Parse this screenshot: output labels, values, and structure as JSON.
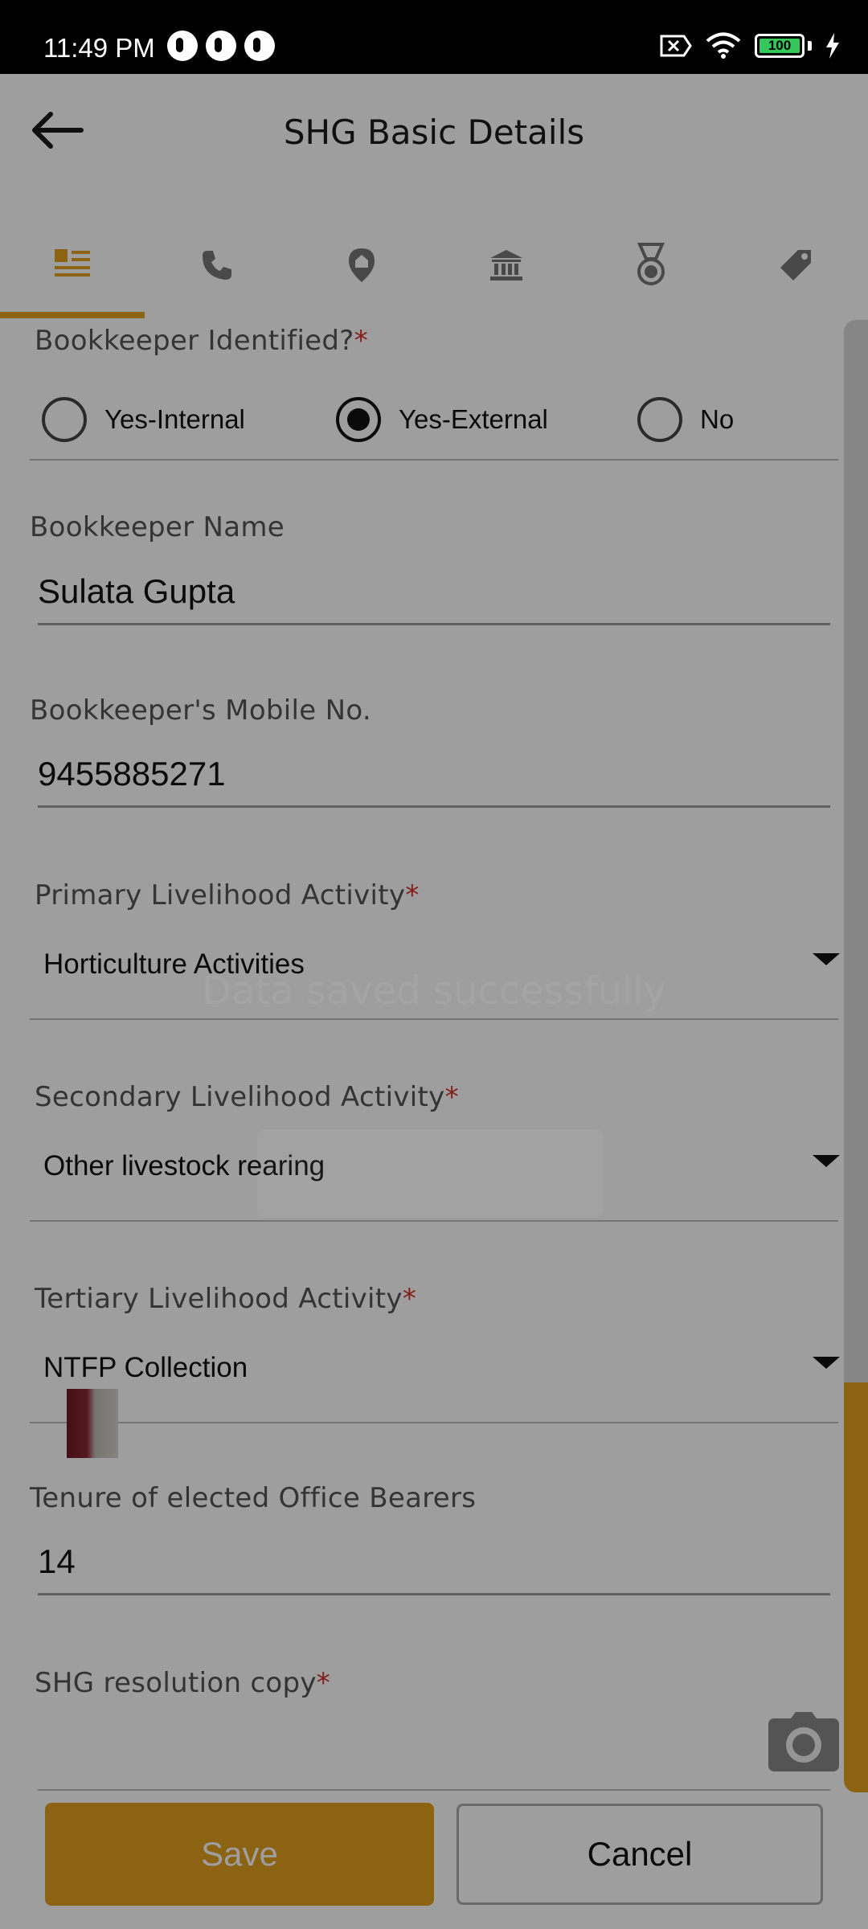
{
  "status_bar": {
    "time": "11:49 PM",
    "battery_level": "100",
    "battery_fill_fraction": 1.0
  },
  "header": {
    "title": "SHG Basic Details",
    "back_icon": "arrow-left-icon"
  },
  "tabs": [
    {
      "icon": "list-details-icon",
      "active": true
    },
    {
      "icon": "phone-icon",
      "active": false
    },
    {
      "icon": "location-pin-icon",
      "active": false
    },
    {
      "icon": "bank-icon",
      "active": false
    },
    {
      "icon": "medal-icon",
      "active": false
    },
    {
      "icon": "tag-icon",
      "active": false
    }
  ],
  "form": {
    "bookkeeper_identified": {
      "label": "Bookkeeper Identified?",
      "required_mark": "*",
      "options": [
        "Yes-Internal",
        "Yes-External",
        "No"
      ],
      "selected": "Yes-External"
    },
    "bookkeeper_name": {
      "label": "Bookkeeper Name",
      "value": "Sulata Gupta"
    },
    "bookkeeper_mobile": {
      "label": "Bookkeeper's Mobile No.",
      "value": "9455885271"
    },
    "primary_livelihood": {
      "label": "Primary Livelihood Activity",
      "required_mark": "*",
      "value": "Horticulture Activities"
    },
    "secondary_livelihood": {
      "label": "Secondary Livelihood Activity",
      "required_mark": "*",
      "value": "Other livestock rearing"
    },
    "tertiary_livelihood": {
      "label": "Tertiary Livelihood Activity",
      "required_mark": "*",
      "value": "NTFP Collection"
    },
    "tenure": {
      "label": "Tenure of elected Office Bearers",
      "value": "14"
    },
    "resolution_copy": {
      "label": "SHG resolution copy",
      "required_mark": "*",
      "camera_icon": "camera-icon"
    }
  },
  "buttons": {
    "save": "Save",
    "cancel": "Cancel"
  },
  "toast": {
    "message": "Data saved successfully"
  },
  "colors": {
    "accent": "#E3A11D",
    "required": "#d32f2f"
  }
}
